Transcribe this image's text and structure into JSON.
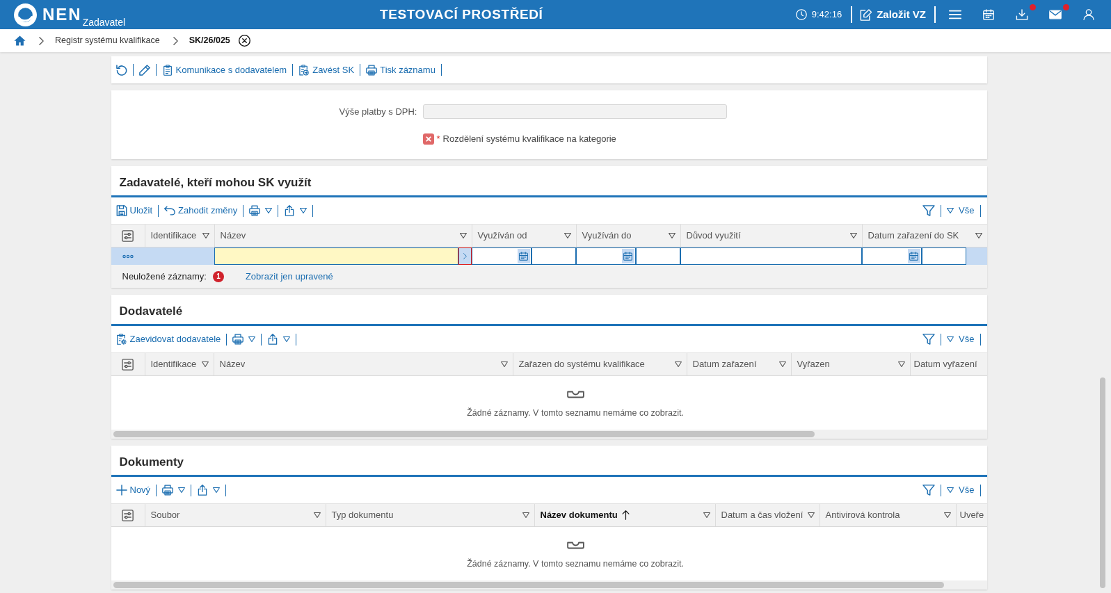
{
  "header": {
    "logo_text": "NEN",
    "logo_subtitle": "Zadavatel",
    "title": "TESTOVACÍ PROSTŘEDÍ",
    "time": "9:42:16",
    "create_button": "Založit VZ",
    "actions": [
      {
        "kind": "menu",
        "notification": false
      },
      {
        "kind": "calendar",
        "notification": false
      },
      {
        "kind": "download",
        "notification": true
      },
      {
        "kind": "mail",
        "notification": true
      },
      {
        "kind": "user",
        "notification": false
      }
    ]
  },
  "breadcrumb": [
    {
      "label": "Registr systému kvalifikace",
      "current": false
    },
    {
      "label": "SK/26/025",
      "current": true
    }
  ],
  "toolbar": [
    {
      "kind": "refresh",
      "dropdown": false
    },
    {
      "kind": "edit",
      "dropdown": false
    },
    {
      "kind": "communication",
      "label": "Komunikace s dodavatelem",
      "dropdown": false
    },
    {
      "kind": "deploy",
      "label": "Zavést SK",
      "dropdown": false
    },
    {
      "kind": "print",
      "label": "Tisk záznamu",
      "dropdown": false
    }
  ],
  "form": {
    "fields": [
      {
        "label": "Výše platby s DPH:",
        "disabled": true
      }
    ],
    "validation": {
      "error": true,
      "required_mark": "*",
      "text": "Rozdělení systému kvalifikace na kategorie"
    }
  },
  "sections": [
    {
      "title": "Zadavatelé, kteří mohou SK využít",
      "toolbar": [
        {
          "kind": "save",
          "label": "Uložit",
          "dropdown": false
        },
        {
          "kind": "discard",
          "label": "Zahodit změny",
          "dropdown": false
        },
        {
          "kind": "print",
          "dropdown": true
        },
        {
          "kind": "export",
          "dropdown": true
        }
      ],
      "filter": {
        "label": "Vše"
      },
      "columns": [
        {
          "label": "Identifikace",
          "sorted": false,
          "menu": true
        },
        {
          "label": "Název",
          "sorted": false,
          "menu": true
        },
        {
          "label": "Využíván od",
          "sorted": false,
          "menu": true
        },
        {
          "label": "Využíván do",
          "sorted": false,
          "menu": true
        },
        {
          "label": "Důvod využití",
          "sorted": false,
          "menu": true
        },
        {
          "label": "Datum zařazení do SK",
          "sorted": false,
          "menu": true
        }
      ],
      "edit_row": {
        "selected": true,
        "cells": [
          {
            "kind": "empty"
          },
          {
            "kind": "lookup",
            "required": true,
            "invalid": true
          },
          {
            "kind": "datetime",
            "required": false,
            "invalid": false
          },
          {
            "kind": "datetime",
            "required": false,
            "invalid": false
          },
          {
            "kind": "text",
            "required": false,
            "invalid": false
          },
          {
            "kind": "datetime",
            "required": false,
            "invalid": false
          }
        ]
      },
      "unsaved": {
        "label": "Neuložené záznamy:",
        "count": "1",
        "link": "Zobrazit jen upravené"
      },
      "horizontal_scroll": false
    },
    {
      "title": "Dodavatelé",
      "toolbar": [
        {
          "kind": "register",
          "label": "Zaevidovat dodavatele",
          "dropdown": false
        },
        {
          "kind": "print",
          "dropdown": true
        },
        {
          "kind": "export",
          "dropdown": true
        }
      ],
      "filter": {
        "label": "Vše"
      },
      "columns": [
        {
          "label": "Identifikace",
          "sorted": false,
          "menu": true
        },
        {
          "label": "Název",
          "sorted": false,
          "menu": true
        },
        {
          "label": "Zařazen do systému kvalifikace",
          "sorted": false,
          "menu": true
        },
        {
          "label": "Datum zařazení",
          "sorted": false,
          "menu": true
        },
        {
          "label": "Vyřazen",
          "sorted": false,
          "menu": true
        },
        {
          "label": "Datum vyřazení",
          "sorted": false,
          "menu": false
        }
      ],
      "empty_text": "Žádné záznamy. V tomto seznamu nemáme co zobrazit.",
      "horizontal_scroll": true
    },
    {
      "title": "Dokumenty",
      "toolbar": [
        {
          "kind": "new",
          "label": "Nový",
          "dropdown": false
        },
        {
          "kind": "print",
          "dropdown": true
        },
        {
          "kind": "export",
          "dropdown": true
        }
      ],
      "filter": {
        "label": "Vše"
      },
      "columns": [
        {
          "label": "Soubor",
          "sorted": false,
          "menu": true
        },
        {
          "label": "Typ dokumentu",
          "sorted": false,
          "menu": true
        },
        {
          "label": "Název dokumentu",
          "sorted": true,
          "menu": true
        },
        {
          "label": "Datum a čas vložení",
          "sorted": false,
          "menu": true
        },
        {
          "label": "Antivirová kontrola",
          "sorted": false,
          "menu": true
        },
        {
          "label": "Uveře",
          "sorted": false,
          "menu": false
        }
      ],
      "empty_text": "Žádné záznamy. V tomto seznamu nemáme co zobrazit.",
      "horizontal_scroll": true
    }
  ]
}
